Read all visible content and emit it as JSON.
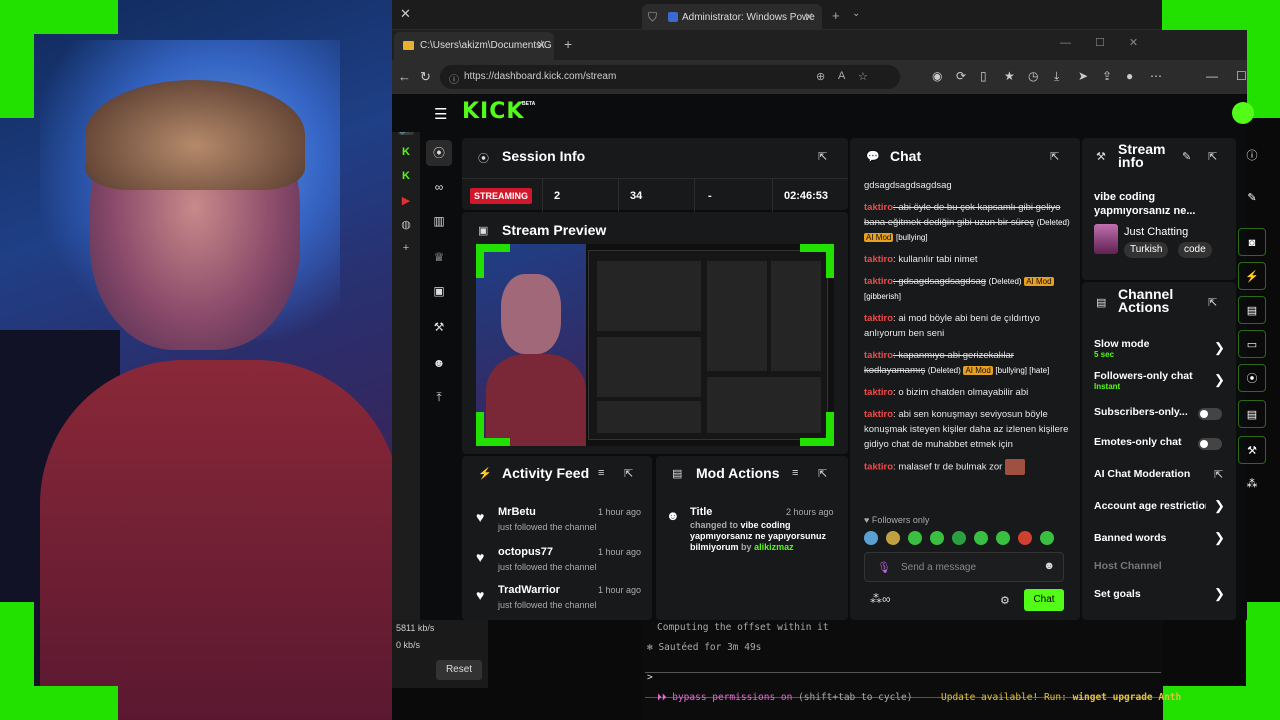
{
  "powershell_tab": {
    "title": "Administrator: Windows Powe"
  },
  "browser": {
    "tab_title": "C:\\Users\\akizm\\Documents\\G",
    "url": "https://dashboard.kick.com/stream"
  },
  "kick": {
    "logo": "KICK",
    "beta": "BETA",
    "session": {
      "title": "Session Info",
      "status": "STREAMING",
      "viewers": "2",
      "followers": "34",
      "dash": "-",
      "uptime": "02:46:53"
    },
    "preview": {
      "title": "Stream Preview"
    },
    "activity": {
      "title": "Activity Feed",
      "items": [
        {
          "name": "MrBetu",
          "time": "1 hour ago",
          "action": "just followed the channel"
        },
        {
          "name": "octopus77",
          "time": "1 hour ago",
          "action": "just followed the channel"
        },
        {
          "name": "TradWarrior",
          "time": "1 hour ago",
          "action": "just followed the channel"
        }
      ]
    },
    "mod_actions": {
      "title": "Mod Actions",
      "item_title": "Title",
      "item_time": "2 hours ago",
      "changed_to": "changed to",
      "new_title": "vibe coding yapmıyorsanız ne yapıyorsunuz bilmiyorum",
      "by": "by",
      "user": "alikizmaz"
    },
    "chat": {
      "title": "Chat",
      "messages": [
        {
          "user": "",
          "text": "gdsagdsagdsagdsag",
          "deleted": "",
          "aimod": "",
          "tag": ""
        },
        {
          "user": "taktiro",
          "text": ": abi öyle de bu çok kapsamlı gibi geliyo bana eğitmek dediğin gibi uzun bir süreç",
          "deleted": "(Deleted)",
          "aimod": "AI Mod",
          "tag": "[bullying]"
        },
        {
          "user": "taktiro",
          "text": ": kullanılır tabi nimet",
          "deleted": "",
          "aimod": "",
          "tag": ""
        },
        {
          "user": "taktiro",
          "text": ": gdsagdsagdsagdsag",
          "deleted": "(Deleted)",
          "aimod": "AI Mod",
          "tag": "[gibberish]"
        },
        {
          "user": "taktiro",
          "text": ": ai mod böyle abi beni de çıldırtıyo anlıyorum ben seni",
          "deleted": "",
          "aimod": "",
          "tag": ""
        },
        {
          "user": "taktiro",
          "text": ": kapanmıyo abi gerizekalılar kodlayamamış",
          "deleted": "(Deleted)",
          "aimod": "AI Mod",
          "tag": "[bullying] [hate]"
        },
        {
          "user": "taktiro",
          "text": ": o bizim chatden olmayabilir abi",
          "deleted": "",
          "aimod": "",
          "tag": ""
        },
        {
          "user": "taktiro",
          "text": ": abi sen konuşmayı seviyosun böyle konuşmak isteyen kişiler daha az izlenen kişilere gidiyo chat de muhabbet etmek için",
          "deleted": "",
          "aimod": "",
          "tag": ""
        },
        {
          "user": "taktiro",
          "text": ": malasef tr de bulmak zor",
          "deleted": "",
          "aimod": "",
          "tag": ""
        }
      ],
      "followers_only": "Followers only",
      "placeholder": "Send a message",
      "send": "Chat"
    },
    "stream_info": {
      "title": "Stream info",
      "stream_title": "vibe coding yapmıyorsanız ne...",
      "category": "Just Chatting",
      "tags": [
        "Turkish",
        "code"
      ]
    },
    "channel_actions": {
      "title": "Channel Actions",
      "items": [
        {
          "label": "Slow mode",
          "sub": "5 sec"
        },
        {
          "label": "Followers-only chat",
          "sub": "Instant"
        },
        {
          "label": "Subscribers-only...",
          "sub": ""
        },
        {
          "label": "Emotes-only chat",
          "sub": ""
        },
        {
          "label": "AI Chat Moderation",
          "sub": ""
        },
        {
          "label": "Account age restriction",
          "sub": ""
        },
        {
          "label": "Banned words",
          "sub": ""
        },
        {
          "label": "Host Channel",
          "sub": ""
        },
        {
          "label": "Set goals",
          "sub": ""
        }
      ]
    }
  },
  "stats": {
    "line1": "5811 kb/s",
    "line2": "0 kb/s",
    "reset": "Reset"
  },
  "terminal": {
    "line1": "Computing the offset within it",
    "line2": "Sautéed for 3m 49s",
    "prompt": ">",
    "bypass": "⏵⏵ bypass permissions on",
    "cycle": "(shift+tab to cycle)",
    "update": "Update available! Run:",
    "cmd": "winget upgrade Anth"
  },
  "colors": {
    "kick_green": "#53fc18",
    "streaming_red": "#d1172b",
    "greenscreen": "#22e000"
  }
}
